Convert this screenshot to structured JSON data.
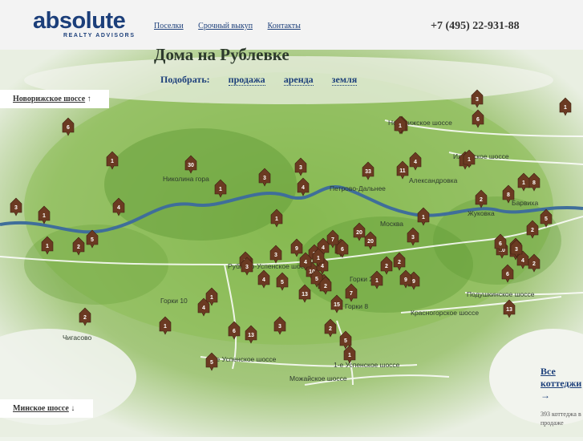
{
  "logo": {
    "word": "absolute",
    "subtitle": "REALTY ADVISORS"
  },
  "nav": [
    "Поселки",
    "Срочный выкуп",
    "Контакты"
  ],
  "phone": "+7 (495) 22-931-88",
  "title": "Дома на Рублевке",
  "filters": {
    "label": "Подобрать:",
    "items": [
      "продажа",
      "аренда",
      "земля"
    ]
  },
  "highway_top": {
    "label": "Новорижское шоссе",
    "arrow": "↑"
  },
  "highway_bottom": {
    "label": "Минское шоссе",
    "arrow": "↓"
  },
  "all_cottages": {
    "label": "Все коттеджи",
    "arrow": "→",
    "count_text": "393 коттеджа в продаже"
  },
  "places": [
    "Николина гора",
    "Петрово-Дальнее",
    "Александровка",
    "Жуковка",
    "Барвиха",
    "Горки 2",
    "Горки 10",
    "Горки 8",
    "Чигасово",
    "Рублево-Успенское шоссе",
    "Ильинское шоссе",
    "Новорижское шоссе",
    "Подушкинское шоссе",
    "Красногорское шоссе",
    "2-е Успенское шоссе",
    "1-е Успенское шоссе",
    "Можайское шоссе",
    "Москва"
  ],
  "pins": [
    "6",
    "1",
    "30",
    "4",
    "1",
    "3",
    "2",
    "1",
    "5",
    "2",
    "1",
    "3",
    "1",
    "3",
    "4",
    "1",
    "33",
    "11",
    "4",
    "2",
    "8",
    "1",
    "3",
    "1",
    "2",
    "6",
    "3",
    "1",
    "8",
    "1",
    "5",
    "2",
    "6",
    "20",
    "20",
    "3",
    "10",
    "13",
    "6",
    "5",
    "4",
    "2",
    "2",
    "3",
    "4",
    "5",
    "9",
    "8",
    "1",
    "5",
    "4",
    "13",
    "6",
    "7",
    "1",
    "7",
    "10",
    "3",
    "4",
    "1",
    "7",
    "4",
    "15",
    "2",
    "13",
    "9",
    "9",
    "5",
    "3",
    "1",
    "1",
    "5",
    "6",
    "1",
    "2",
    "3",
    "2",
    "4",
    "8",
    "6",
    "3"
  ],
  "colors": {
    "brand": "#1c3f7a",
    "pin": "#6b3a22",
    "river": "#3f6e9a",
    "forest": "#5f9a35"
  }
}
